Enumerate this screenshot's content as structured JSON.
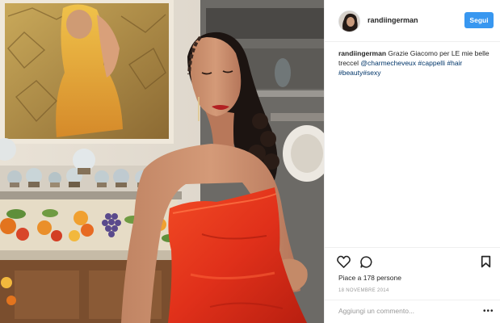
{
  "post": {
    "username": "randiingerman",
    "follow_label": "Segui",
    "caption": {
      "username": "randiingerman",
      "text": " Grazie Giacomo per LE mie belle treccel ",
      "mention": "@charmecheveux",
      "tags": [
        "#cappelli",
        "#hair",
        "#beauty",
        "#sexy"
      ]
    },
    "likes": "Piace a 178 persone",
    "date": "18 NOVEMBRE 2014",
    "comment_placeholder": "Aggiungi un commento...",
    "more_label": "•••"
  },
  "icons": {
    "like": "heart-icon",
    "comment": "comment-icon",
    "save": "bookmark-icon",
    "more": "more-options-icon"
  },
  "colors": {
    "accent": "#3897f0",
    "link": "#003569",
    "dress": "#e8341c"
  }
}
